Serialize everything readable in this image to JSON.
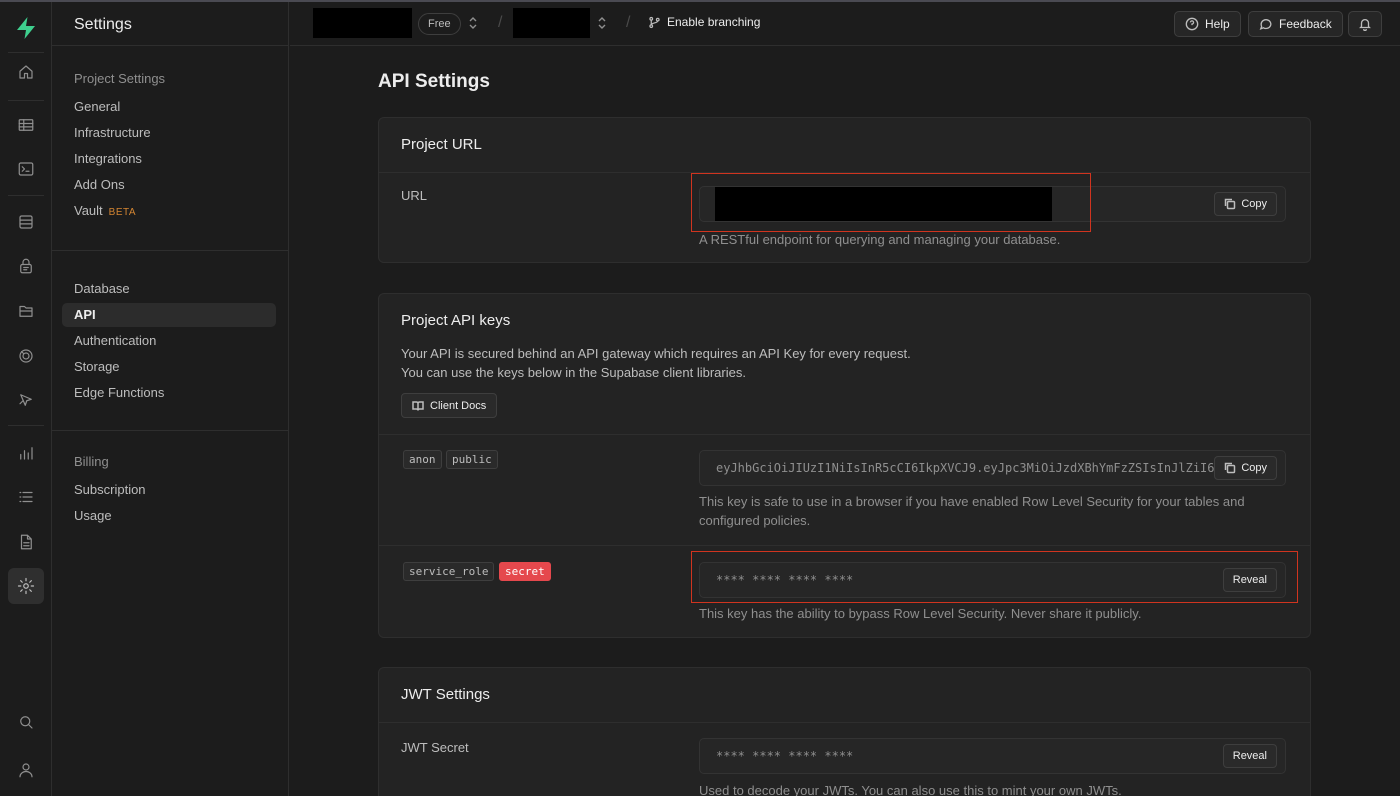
{
  "rail": {
    "icons": [
      "home-icon",
      "table-editor-icon",
      "sql-editor-icon",
      "database-icon",
      "auth-icon",
      "storage-icon",
      "realtime-icon",
      "edge-functions-icon",
      "reports-icon",
      "logs-icon",
      "api-docs-icon",
      "settings-icon",
      "search-icon",
      "user-icon"
    ],
    "active": "settings-icon"
  },
  "sidebar": {
    "title": "Settings",
    "groups": [
      {
        "heading": "Project Settings",
        "items": [
          "General",
          "Infrastructure",
          "Integrations",
          "Add Ons",
          "Vault"
        ]
      },
      {
        "heading": "",
        "items": [
          "Database",
          "API",
          "Authentication",
          "Storage",
          "Edge Functions"
        ]
      },
      {
        "heading": "Billing",
        "items": [
          "Subscription",
          "Usage"
        ]
      }
    ],
    "vault_badge": "BETA",
    "active_item": "API"
  },
  "topbar": {
    "plan_badge": "Free",
    "separator": "/",
    "branching_label": "Enable branching",
    "help_label": "Help",
    "feedback_label": "Feedback"
  },
  "main": {
    "page_title": "API Settings",
    "project_url": {
      "title": "Project URL",
      "label": "URL",
      "copy_label": "Copy",
      "help": "A RESTful endpoint for querying and managing your database."
    },
    "api_keys": {
      "title": "Project API keys",
      "desc_line1": "Your API is secured behind an API gateway which requires an API Key for every request.",
      "desc_line2": "You can use the keys below in the Supabase client libraries.",
      "docs_button": "Client Docs",
      "anon": {
        "tag1": "anon",
        "tag2": "public",
        "value": "eyJhbGciOiJIUzI1NiIsInR5cCI6IkpXVCJ9.eyJpc3MiOiJzdXBhYmFzZSIsInJlZiI6",
        "copy_label": "Copy",
        "help": "This key is safe to use in a browser if you have enabled Row Level Security for your tables and configured policies."
      },
      "service_role": {
        "tag1": "service_role",
        "tag2": "secret",
        "value": "**** **** **** ****",
        "reveal_label": "Reveal",
        "help": "This key has the ability to bypass Row Level Security. Never share it publicly."
      }
    },
    "jwt": {
      "title": "JWT Settings",
      "label": "JWT Secret",
      "value": "**** **** **** ****",
      "reveal_label": "Reveal",
      "help": "Used to decode your JWTs. You can also use this to mint your own JWTs."
    }
  },
  "colors": {
    "background": "#1c1c1c",
    "panel": "#232323",
    "brand": "#3ecf8e",
    "secret_badge": "#e5484d",
    "beta": "#d38532",
    "highlight_box": "#d0341f"
  }
}
